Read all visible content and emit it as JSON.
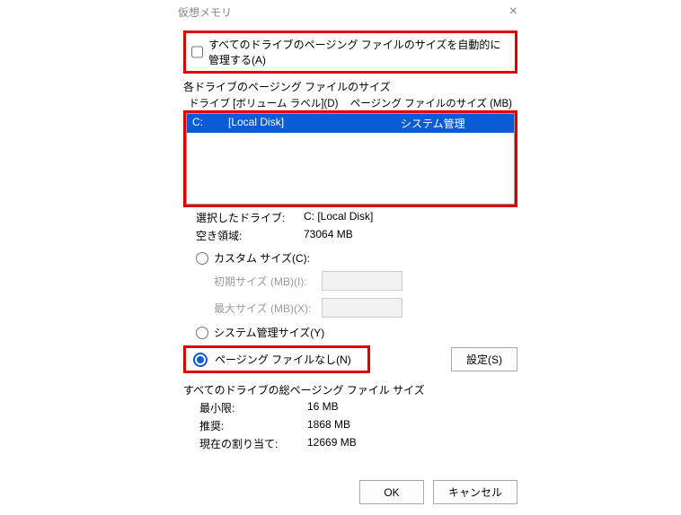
{
  "title": "仮想メモリ",
  "auto_manage_label": "すべてのドライブのページング ファイルのサイズを自動的に管理する(A)",
  "per_drive_label": "各ドライブのページング ファイルのサイズ",
  "col_drive": "ドライブ  [ボリューム ラベル](D)",
  "col_size": "ページング ファイルのサイズ (MB)",
  "selected_row": {
    "drive": "C:",
    "label": "[Local Disk]",
    "size": "システム管理"
  },
  "selected_drive_label": "選択したドライブ:",
  "selected_drive_value": "C:  [Local Disk]",
  "free_space_label": "空き領域:",
  "free_space_value": "73064 MB",
  "custom_size_label": "カスタム サイズ(C):",
  "initial_size_label": "初期サイズ (MB)(I):",
  "max_size_label": "最大サイズ (MB)(X):",
  "system_managed_label": "システム管理サイズ(Y)",
  "no_paging_label": "ページング ファイルなし(N)",
  "set_button": "設定(S)",
  "totals_header": "すべてのドライブの総ページング ファイル サイズ",
  "min_label": "最小限:",
  "min_value": "16 MB",
  "rec_label": "推奨:",
  "rec_value": "1868 MB",
  "cur_label": "現在の割り当て:",
  "cur_value": "12669 MB",
  "ok": "OK",
  "cancel": "キャンセル"
}
